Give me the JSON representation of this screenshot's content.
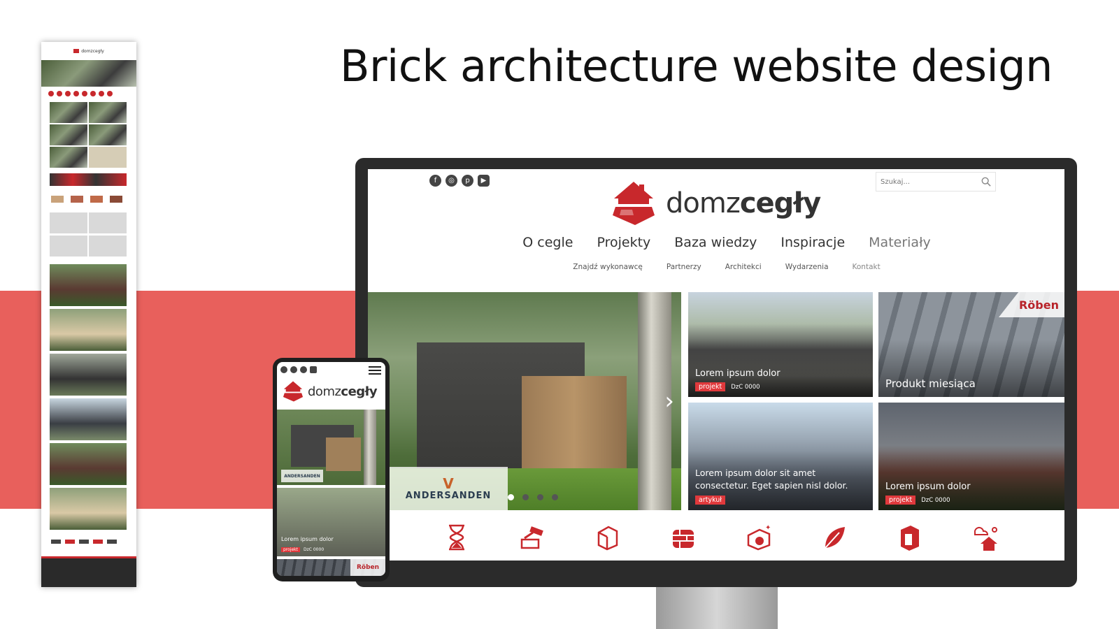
{
  "headline": "Brick architecture website design",
  "colors": {
    "accent_red": "#e8605c",
    "brand_red": "#c8282c",
    "tag_red": "#e0393c"
  },
  "site": {
    "logo": {
      "light": "domz",
      "bold": "cegły",
      "icon": "brick-house-icon"
    },
    "social_icons": [
      "facebook-icon",
      "instagram-icon",
      "pinterest-icon",
      "youtube-icon"
    ],
    "search": {
      "placeholder": "Szukaj..."
    },
    "main_nav": [
      "O cegle",
      "Projekty",
      "Baza wiedzy",
      "Inspiracje",
      "Materiały"
    ],
    "sub_nav": [
      "Znajdź wykonawcę",
      "Partnerzy",
      "Architekci",
      "Wydarzenia",
      "Kontakt"
    ],
    "hero": {
      "partner_logo": "ANDERSANDEN",
      "dots": 4,
      "active_dot": 0
    },
    "tiles": [
      {
        "title": "Lorem ipsum dolor",
        "tag": "projekt",
        "code": "DzC 0000"
      },
      {
        "title": "Produkt miesiąca",
        "partner": "Röben"
      },
      {
        "title_line1": "Lorem ipsum dolor sit amet",
        "title_line2": "consectetur. Eget sapien nisl dolor.",
        "tag": "artykuł"
      },
      {
        "title": "Lorem ipsum dolor",
        "tag": "projekt",
        "code": "DzC 0000"
      }
    ],
    "feature_icons": [
      "hourglass-icon",
      "hammer-brick-icon",
      "brick-box-icon",
      "brick-wall-icon",
      "brick-certified-icon",
      "leaf-icon",
      "brick-corner-icon",
      "weather-house-icon"
    ]
  },
  "phone": {
    "logo": {
      "light": "domz",
      "bold": "cegły"
    },
    "tile": {
      "title": "Lorem ipsum dolor",
      "tag": "projekt",
      "code": "DzC 0000"
    },
    "partner": "Röben",
    "hero_partner": "ANDERSANDEN"
  },
  "longpage": {
    "logo": "domzcegły"
  }
}
